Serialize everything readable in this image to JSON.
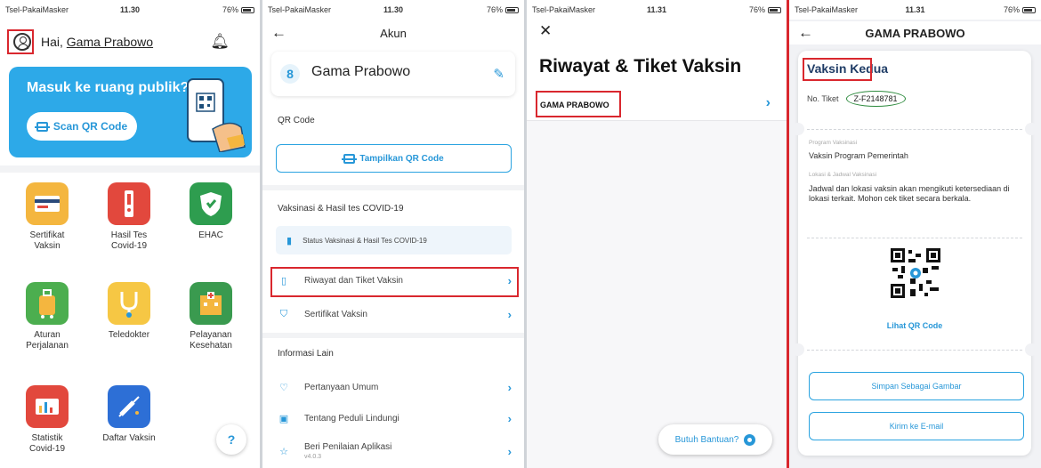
{
  "status": [
    {
      "carrier": "Tsel-PakaiMasker",
      "time": "11.30",
      "battery": "76%"
    },
    {
      "carrier": "Tsel-PakaiMasker",
      "time": "11.30",
      "battery": "76%"
    },
    {
      "carrier": "Tsel-PakaiMasker",
      "time": "11.31",
      "battery": "76%"
    },
    {
      "carrier": "Tsel-PakaiMasker",
      "time": "11.31",
      "battery": "76%"
    }
  ],
  "home": {
    "greeting": "Hai,",
    "user_name": "Gama Prabowo",
    "banner_title": "Masuk ke ruang publik?",
    "scan_label": "Scan QR Code",
    "tiles": [
      {
        "label": "Sertifikat\nVaksin",
        "icon": "certificate-icon",
        "color": "#f4b63f"
      },
      {
        "label": "Hasil Tes\nCovid-19",
        "icon": "test-tube-icon",
        "color": "#e2483d"
      },
      {
        "label": "EHAC",
        "icon": "shield-icon",
        "color": "#2e9d4f"
      },
      {
        "label": "Aturan\nPerjalanan",
        "icon": "luggage-icon",
        "color": "#4cae4f"
      },
      {
        "label": "Teledokter",
        "icon": "stethoscope-icon",
        "color": "#f6c744"
      },
      {
        "label": "Pelayanan\nKesehatan",
        "icon": "hospital-icon",
        "color": "#3a9a4f"
      },
      {
        "label": "Statistik\nCovid-19",
        "icon": "chart-icon",
        "color": "#e2483d"
      },
      {
        "label": "Daftar Vaksin",
        "icon": "syringe-icon",
        "color": "#2d6fd6"
      }
    ],
    "help_icon": "?"
  },
  "akun": {
    "title": "Akun",
    "name": "Gama Prabowo",
    "qr_section": "QR Code",
    "show_qr": "Tampilkan QR Code",
    "vax_section": "Vaksinasi & Hasil tes COVID-19",
    "status_row": "Status Vaksinasi & Hasil Tes COVID-19",
    "riwayat": "Riwayat dan Tiket Vaksin",
    "sertifikat": "Sertifikat Vaksin",
    "info_section": "Informasi Lain",
    "faq": "Pertanyaan Umum",
    "about": "Tentang Peduli Lindungi",
    "rate": "Beri Penilaian Aplikasi",
    "rate_sub": "v4.0.3"
  },
  "riwayat": {
    "title": "Riwayat & Tiket Vaksin",
    "row_name": "GAMA PRABOWO",
    "help_label": "Butuh Bantuan?"
  },
  "ticket": {
    "nav_title": "GAMA PRABOWO",
    "title": "Vaksin Kedua",
    "no_label": "No. Tiket",
    "no_value": "Z-F2148781",
    "program_label": "Program Vaksinasi",
    "program_value": "Vaksin Program Pemerintah",
    "lokasi_label": "Lokasi & Jadwal Vaksinasi",
    "lokasi_value": "Jadwal dan lokasi vaksin akan mengikuti ketersediaan di lokasi terkait. Mohon cek tiket secara berkala.",
    "qr_link": "Lihat QR Code",
    "save_btn": "Simpan Sebagai Gambar",
    "email_btn": "Kirim ke E-mail"
  },
  "colors": {
    "accent": "#2797d8",
    "highlight": "#d9272e",
    "title_navy": "#1f3c66"
  }
}
